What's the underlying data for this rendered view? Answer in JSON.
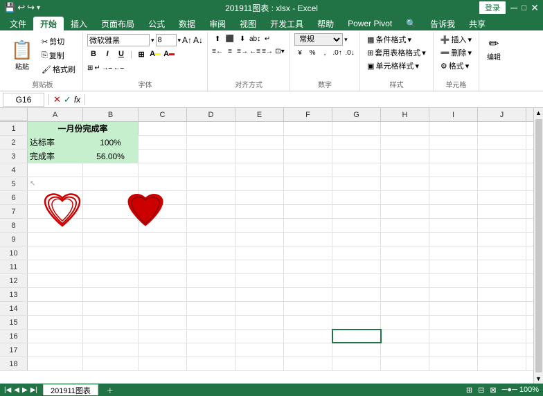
{
  "titlebar": {
    "title": "201911图表 : xlsx - Excel",
    "login_label": "登录"
  },
  "qat": {
    "buttons": [
      "💾",
      "↩",
      "↪",
      "▾"
    ]
  },
  "tabs": {
    "items": [
      "文件",
      "开始",
      "插入",
      "页面布局",
      "公式",
      "数据",
      "审阅",
      "视图",
      "开发工具",
      "帮助",
      "Power Pivot",
      "🔍",
      "告诉我",
      "共享"
    ]
  },
  "ribbon": {
    "clipboard_label": "剪贴板",
    "paste_label": "粘贴",
    "cut_label": "剪切",
    "copy_label": "复制",
    "format_painter_label": "格式刷",
    "font_label": "字体",
    "font_name": "微软雅黑",
    "font_size": "8",
    "bold": "B",
    "italic": "I",
    "underline": "U",
    "align_label": "对齐方式",
    "number_label": "数字",
    "number_format": "常规",
    "style_label": "样式",
    "cond_fmt": "条件格式",
    "table_fmt": "套用表格格式",
    "cell_fmt": "单元格样式",
    "cell_label": "单元格",
    "insert_label": "插入",
    "delete_label": "删除",
    "format_label": "格式",
    "edit_label": "编辑"
  },
  "formula_bar": {
    "cell_ref": "G16",
    "fx": "fx"
  },
  "grid": {
    "columns": [
      "A",
      "B",
      "C",
      "D",
      "E",
      "F",
      "G",
      "H",
      "I",
      "J"
    ],
    "rows": [
      1,
      2,
      3,
      4,
      5,
      6,
      7,
      8,
      9,
      10,
      11,
      12,
      13,
      14,
      15,
      16,
      17,
      18
    ],
    "cell_data": {
      "A1": "一月份完成率",
      "A2": "达标率",
      "B2": "100%",
      "A3": "完成率",
      "B3": "56.00%"
    }
  },
  "sheets": {
    "tabs": [
      "201911图表"
    ]
  },
  "hearts": {
    "outline_color": "#cc0000",
    "fill_color": "#cc0000"
  }
}
